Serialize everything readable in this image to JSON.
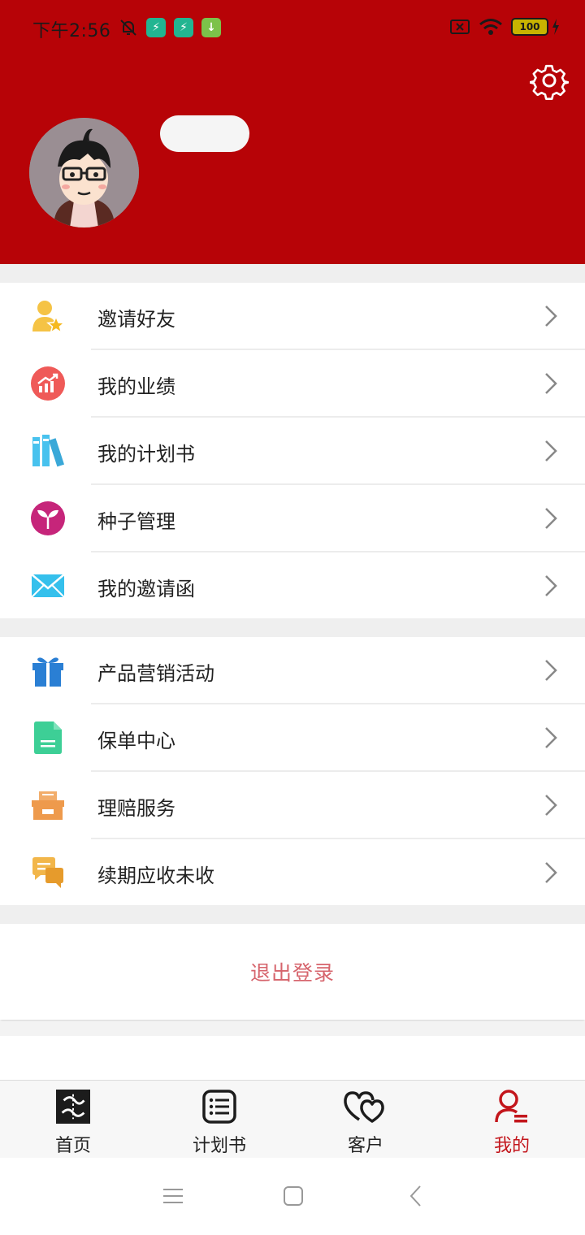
{
  "status_bar": {
    "time": "下午2:56",
    "battery": "100"
  },
  "menu_group_1": [
    {
      "label": "邀请好友",
      "icon": "invite-friend-icon"
    },
    {
      "label": "我的业绩",
      "icon": "performance-chart-icon"
    },
    {
      "label": "我的计划书",
      "icon": "books-icon"
    },
    {
      "label": "种子管理",
      "icon": "seedling-icon"
    },
    {
      "label": "我的邀请函",
      "icon": "envelope-icon"
    }
  ],
  "menu_group_2": [
    {
      "label": "产品营销活动",
      "icon": "gift-icon"
    },
    {
      "label": "保单中心",
      "icon": "policy-document-icon"
    },
    {
      "label": "理赔服务",
      "icon": "claims-box-icon"
    },
    {
      "label": "续期应收未收",
      "icon": "chat-bubbles-icon"
    }
  ],
  "logout": {
    "label": "退出登录"
  },
  "tabbar": [
    {
      "label": "首页",
      "icon": "home-logo-icon",
      "active": false
    },
    {
      "label": "计划书",
      "icon": "list-icon",
      "active": false
    },
    {
      "label": "客户",
      "icon": "hearts-icon",
      "active": false
    },
    {
      "label": "我的",
      "icon": "profile-icon",
      "active": true
    }
  ],
  "colors": {
    "header": "#b70307",
    "accent": "#c3161c",
    "logout_text": "#d6646c"
  }
}
